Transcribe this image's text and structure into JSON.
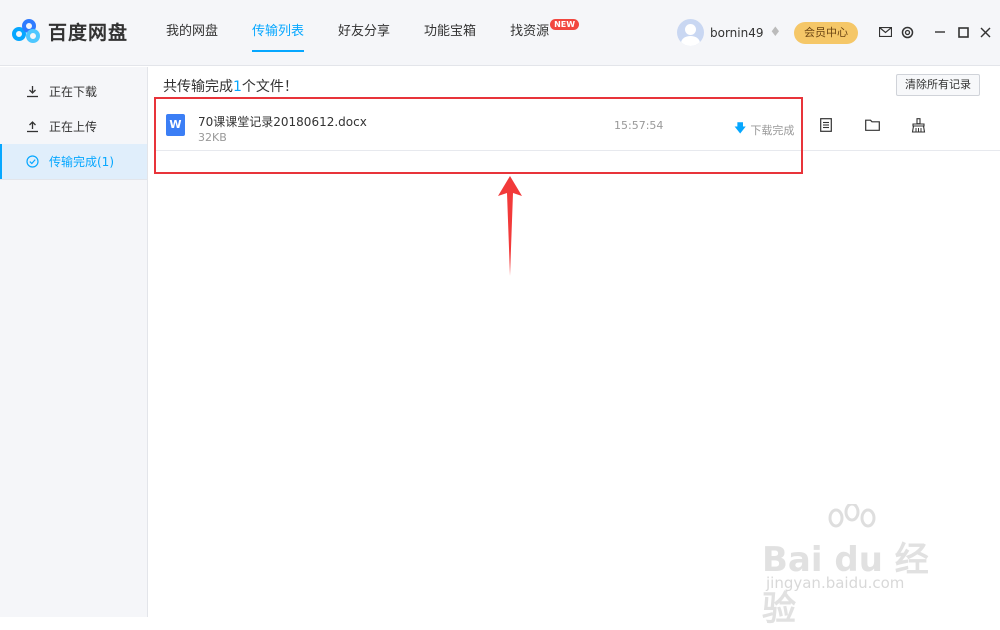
{
  "app": {
    "logo_text": "百度网盘"
  },
  "nav": {
    "tabs": [
      {
        "label": "我的网盘"
      },
      {
        "label": "传输列表"
      },
      {
        "label": "好友分享"
      },
      {
        "label": "功能宝箱"
      },
      {
        "label": "找资源",
        "badge": "NEW"
      }
    ],
    "active": "传输列表"
  },
  "user": {
    "name": "bornin49",
    "vip_label": "会员中心"
  },
  "sidebar": {
    "items": [
      {
        "label": "正在下载"
      },
      {
        "label": "正在上传"
      },
      {
        "label": "传输完成(1)"
      }
    ]
  },
  "main": {
    "summary_prefix": "共传输完成",
    "summary_count": "1",
    "summary_suffix": "个文件！",
    "clear_label": "清除所有记录",
    "files": [
      {
        "icon_letter": "W",
        "name": "70课课堂记录20180612.docx",
        "size": "32KB",
        "time": "15:57:54",
        "status": "下载完成"
      }
    ]
  },
  "watermark": {
    "text": "Bai du 经验",
    "sub": "jingyan.baidu.com"
  },
  "colors": {
    "accent": "#06a7ff",
    "highlight": "#e8343a",
    "vip": "#f5c768"
  }
}
